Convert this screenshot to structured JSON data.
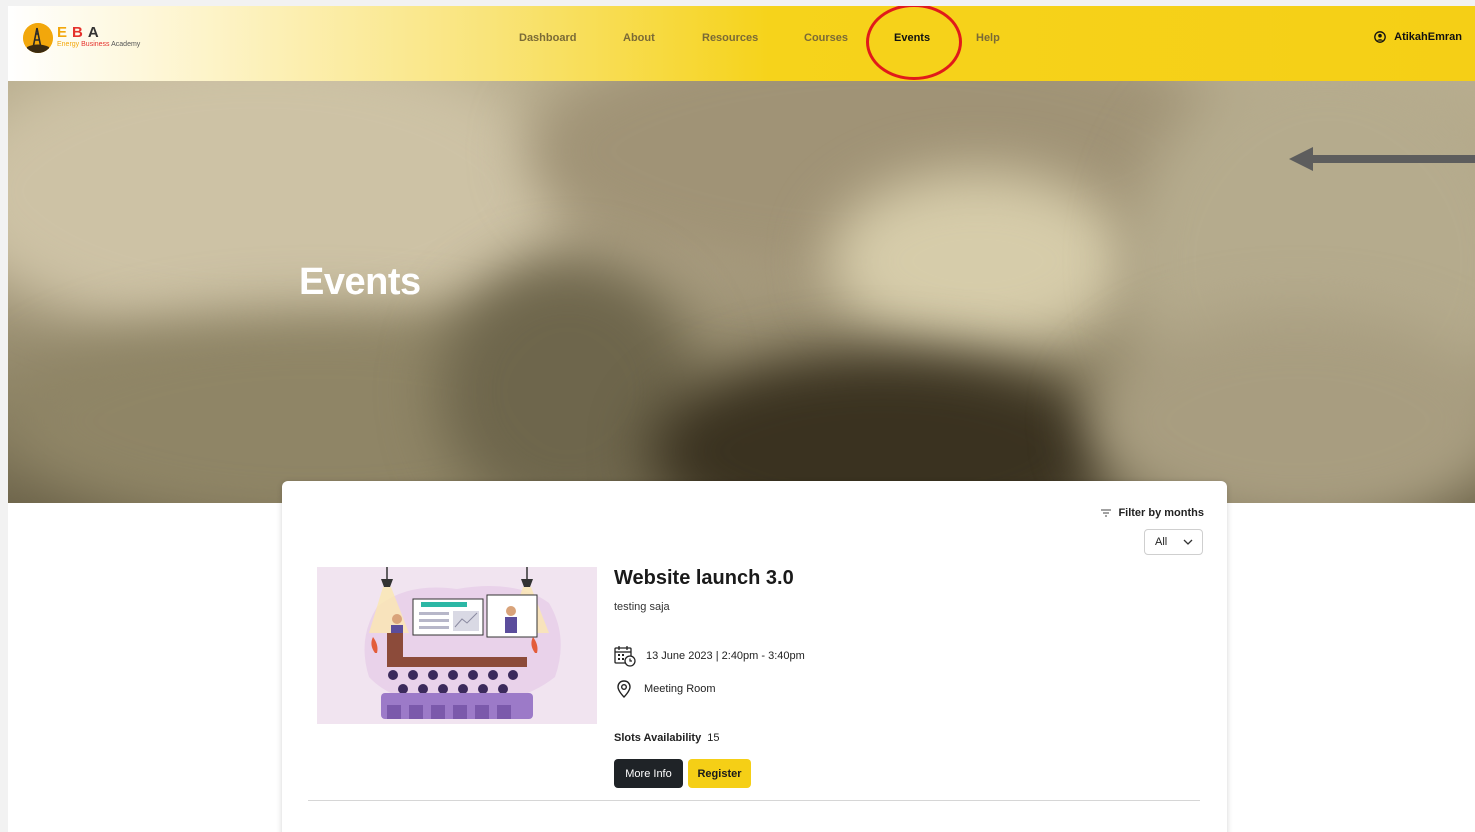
{
  "brand": {
    "letters": [
      "E",
      "B",
      "A"
    ],
    "tagline_parts": [
      "Energy",
      "Business",
      "Academy"
    ],
    "colors": {
      "orange": "#f2a70b",
      "red": "#e5322d",
      "yellow": "#f5cf16"
    }
  },
  "nav": {
    "items": [
      {
        "label": "Dashboard"
      },
      {
        "label": "About"
      },
      {
        "label": "Resources"
      },
      {
        "label": "Courses"
      },
      {
        "label": "Events",
        "active": true
      },
      {
        "label": "Help"
      }
    ]
  },
  "user": {
    "name": "AtikahEmran",
    "icon": "user-circle-icon"
  },
  "hero": {
    "title": "Events"
  },
  "filter": {
    "label": "Filter by months",
    "selected": "All",
    "icon": "filter-lines-icon"
  },
  "event": {
    "title": "Website launch 3.0",
    "description": "testing saja",
    "datetime": "13 June 2023 | 2:40pm - 3:40pm",
    "location": "Meeting Room",
    "slots_label": "Slots Availability",
    "slots_value": "15",
    "more_info_label": "More Info",
    "register_label": "Register"
  },
  "annotations": {
    "highlight_color": "#e11a1a",
    "arrow_color": "#5d5d5d"
  }
}
